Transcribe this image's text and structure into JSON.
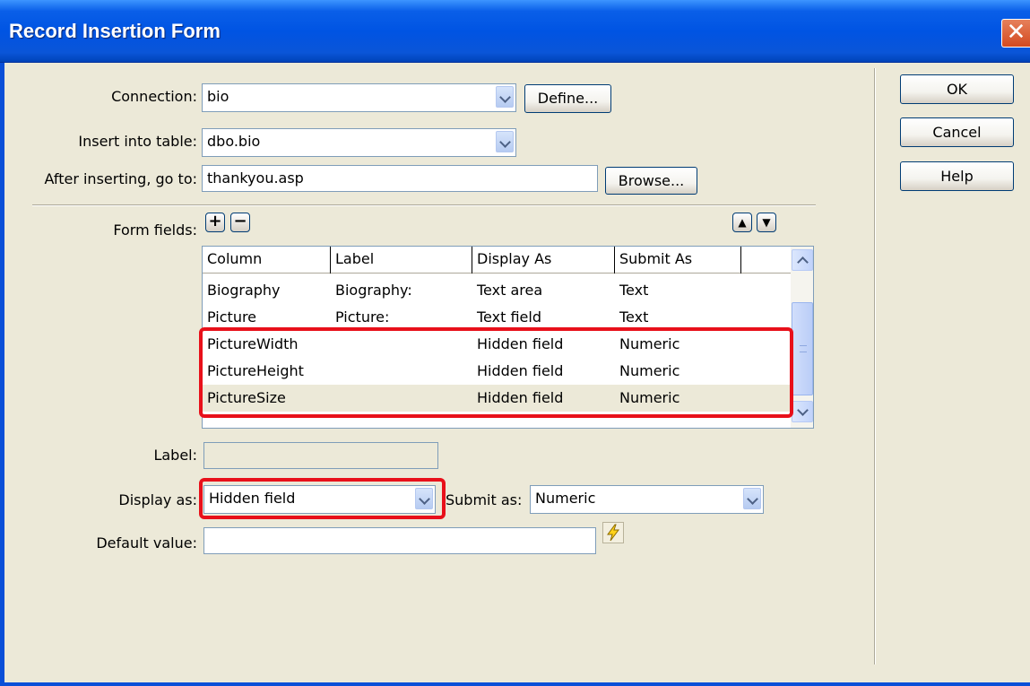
{
  "dialog": {
    "title": "Record Insertion Form",
    "close_glyph": "✕"
  },
  "connection": {
    "label": "Connection:",
    "value": "bio",
    "define_button": "Define..."
  },
  "table": {
    "label": "Insert into table:",
    "value": "dbo.bio"
  },
  "redirect": {
    "label": "After inserting, go to:",
    "value": "thankyou.asp",
    "browse_button": "Browse..."
  },
  "form_fields": {
    "label": "Form fields:",
    "add_glyph": "+",
    "remove_glyph": "−",
    "up_glyph": "▲",
    "down_glyph": "▼",
    "columns": [
      "Column",
      "Label",
      "Display As",
      "Submit As"
    ],
    "rows": [
      {
        "column": "Biography",
        "label": "Biography:",
        "display_as": "Text area",
        "submit_as": "Text"
      },
      {
        "column": "Picture",
        "label": "Picture:",
        "display_as": "Text field",
        "submit_as": "Text"
      },
      {
        "column": "PictureWidth",
        "label": "",
        "display_as": "Hidden field",
        "submit_as": "Numeric"
      },
      {
        "column": "PictureHeight",
        "label": "",
        "display_as": "Hidden field",
        "submit_as": "Numeric"
      },
      {
        "column": "PictureSize",
        "label": "",
        "display_as": "Hidden field",
        "submit_as": "Numeric"
      }
    ]
  },
  "field_label": {
    "label": "Label:",
    "value": ""
  },
  "display_as": {
    "label": "Display as:",
    "value": "Hidden field"
  },
  "submit_as": {
    "label": "Submit as:",
    "value": "Numeric"
  },
  "default_value": {
    "label": "Default value:",
    "value": ""
  },
  "buttons": {
    "ok": "OK",
    "cancel": "Cancel",
    "help": "Help"
  },
  "colors": {
    "title_bar": "#0054E3",
    "dialog_bg": "#ECE9D8",
    "highlight": "#E8101A",
    "close_button": "#D34A20"
  },
  "icons": {
    "dynamic_data": "lightning-icon"
  }
}
